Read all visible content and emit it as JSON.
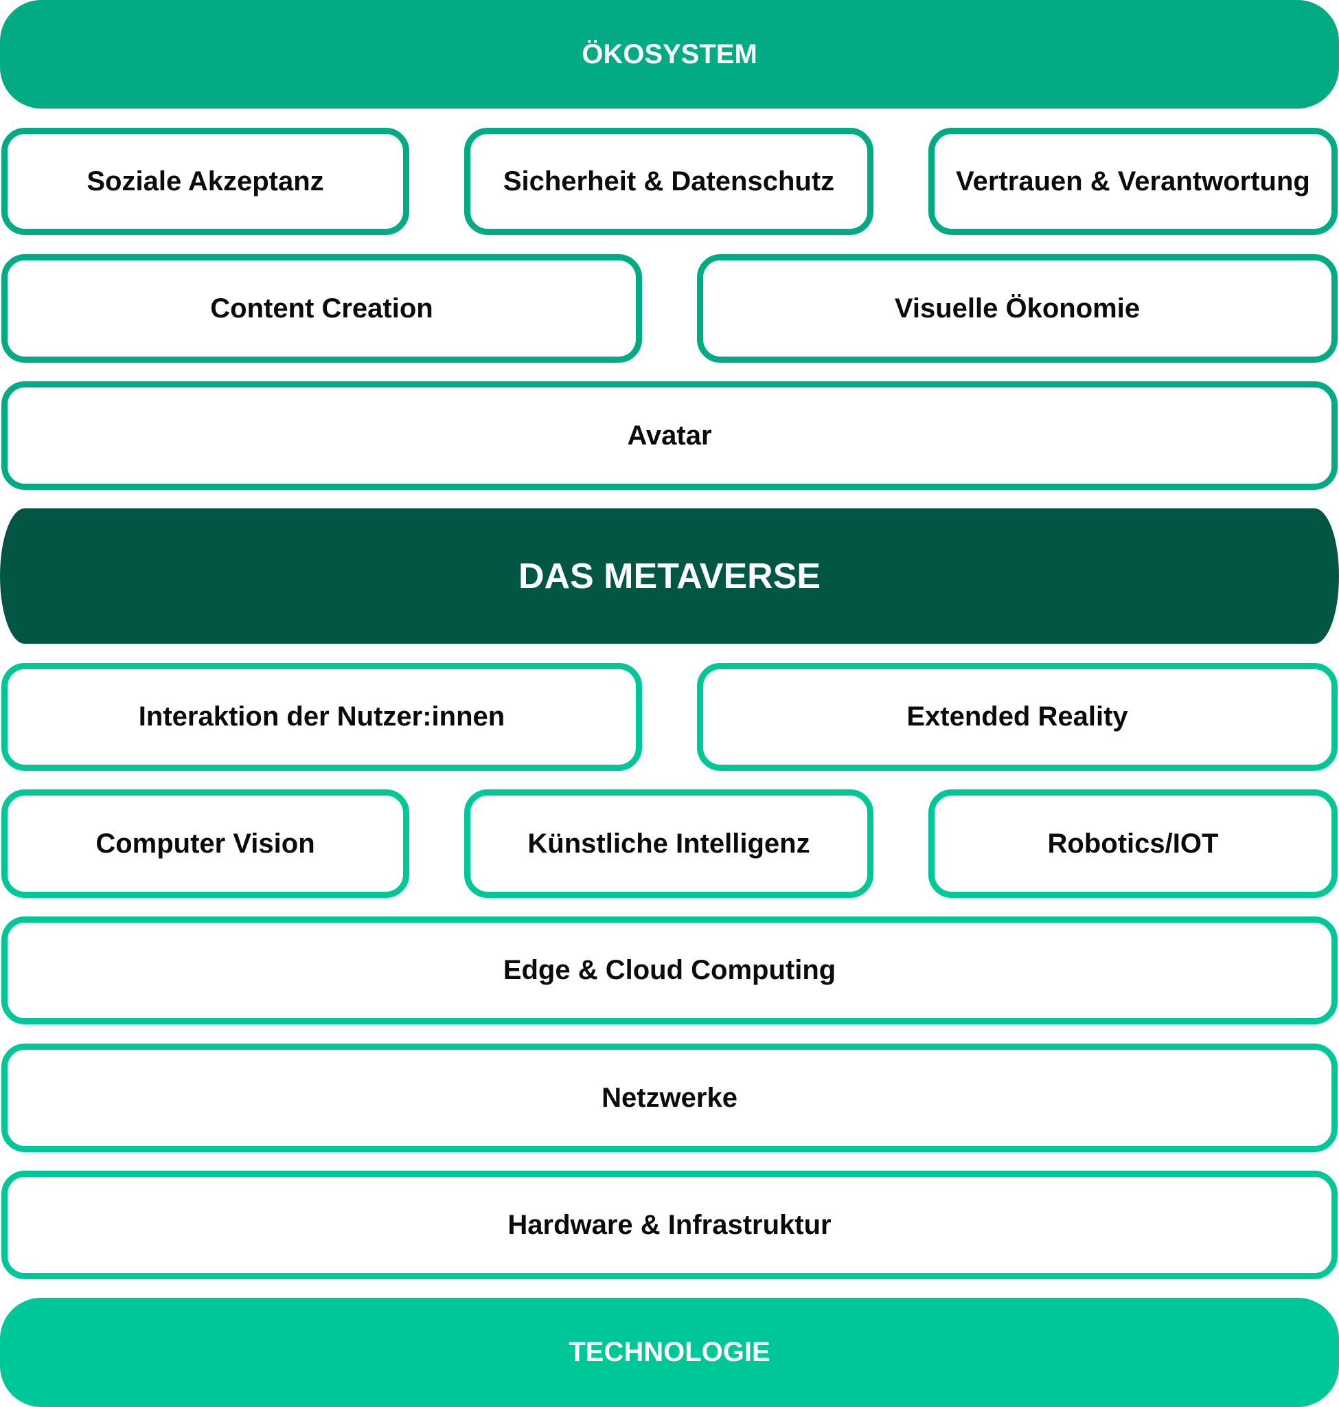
{
  "colors": {
    "ecosystem_green": "#02AB83",
    "metaverse_dark_green": "#025744",
    "technology_green": "#00C798",
    "label_text": "#0b0b0b",
    "band_text": "#ffffff"
  },
  "ecosystem": {
    "title": "ÖKOSYSTEM",
    "rows": [
      [
        "Soziale Akzeptanz",
        "Sicherheit & Datenschutz",
        "Vertrauen & Verantwortung"
      ],
      [
        "Content Creation",
        "Visuelle Ökonomie"
      ],
      [
        "Avatar"
      ]
    ]
  },
  "center": {
    "title": "DAS METAVERSE"
  },
  "technology": {
    "rows": [
      [
        "Interaktion der Nutzer:innen",
        "Extended Reality"
      ],
      [
        "Computer Vision",
        "Künstliche Intelligenz",
        "Robotics/IOT"
      ],
      [
        "Edge & Cloud Computing"
      ],
      [
        "Netzwerke"
      ],
      [
        "Hardware & Infrastruktur"
      ]
    ],
    "title": "TECHNOLOGIE"
  }
}
